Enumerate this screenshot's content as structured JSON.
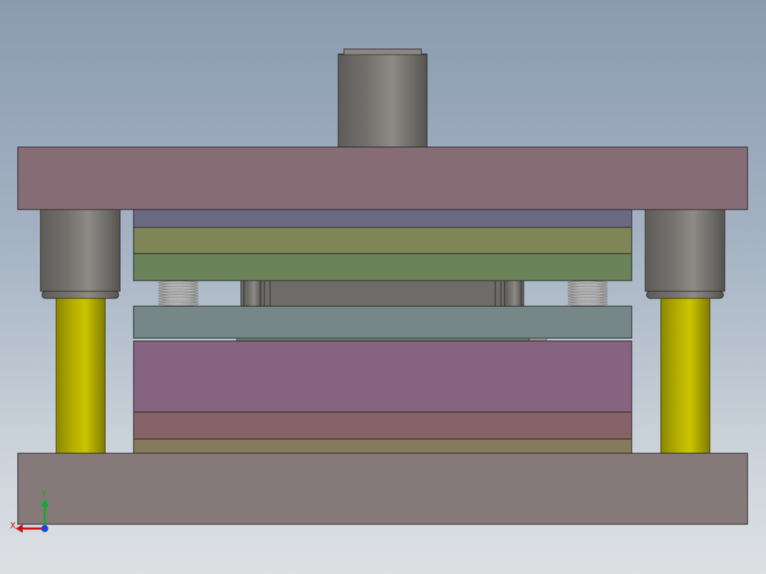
{
  "viewport": {
    "background_top": "#8a9bb0",
    "background_bottom": "#dde1e4"
  },
  "components": {
    "shank": {
      "color": "#7d7a76"
    },
    "top_plate": {
      "color": "#866c74"
    },
    "backing_plate": {
      "color": "#6a6a85"
    },
    "punch_holder": {
      "color": "#7f8556"
    },
    "punch_plate": {
      "color": "#6a8358"
    },
    "stripper_plate": {
      "color": "#758786"
    },
    "die_plate": {
      "color": "#866381"
    },
    "die_backing": {
      "color": "#876266"
    },
    "die_spacer": {
      "color": "#857a5e"
    },
    "bottom_plate": {
      "color": "#857a79"
    },
    "guide_bushing": {
      "color": "#7b7874"
    },
    "guide_post": {
      "color": "#b2ad00"
    },
    "spring": {
      "color": "#c8c8c8"
    },
    "punch": {
      "color": "#6e6c69"
    }
  },
  "triad": {
    "x_label": "X",
    "y_label": "Y",
    "x_color": "#cc1111",
    "y_color": "#11aa33",
    "z_color": "#2244dd"
  }
}
